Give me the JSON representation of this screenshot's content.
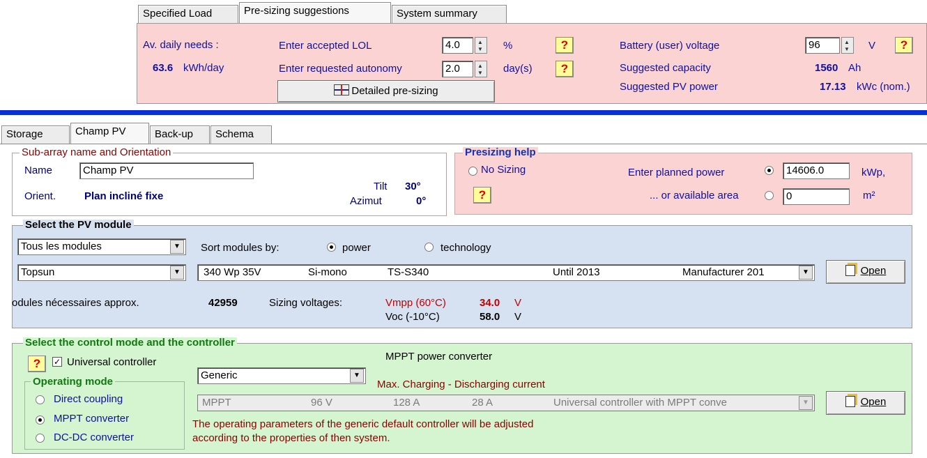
{
  "top_tabs": [
    "Specified Load",
    "Pre-sizing suggestions",
    "System summary"
  ],
  "presizing": {
    "av_daily_needs_label": "Av. daily needs :",
    "av_daily_value": "63.6",
    "av_daily_unit": "kWh/day",
    "lol_label": "Enter accepted LOL",
    "lol_value": "4.0",
    "lol_unit": "%",
    "autonomy_label": "Enter requested autonomy",
    "autonomy_value": "2.0",
    "autonomy_unit": "day(s)",
    "detailed_button": "Detailed pre-sizing",
    "battery_voltage_label": "Battery (user) voltage",
    "battery_voltage_value": "96",
    "battery_voltage_unit": "V",
    "capacity_label": "Suggested capacity",
    "capacity_value": "1560",
    "capacity_unit": "Ah",
    "pv_power_label": "Suggested PV power",
    "pv_power_value": "17.13",
    "pv_power_unit": "kWc (nom.)",
    "help_mark": "?"
  },
  "sub_tabs": [
    "Storage",
    "Champ PV",
    "Back-up",
    "Schema"
  ],
  "subarray": {
    "legend": "Sub-array name and Orientation",
    "name_label": "Name",
    "name_value": "Champ PV",
    "orient_label": "Orient.",
    "orient_value": "Plan incliné fixe",
    "tilt_label": "Tilt",
    "tilt_value": "30°",
    "azimut_label": "Azimut",
    "azimut_value": "0°"
  },
  "presizing_help": {
    "legend": "Presizing help",
    "no_sizing": "No Sizing",
    "planned_power_label": "Enter planned power",
    "planned_power_value": "14606.0",
    "planned_power_unit": "kWp,",
    "area_label": "... or available area",
    "area_value": "0",
    "area_unit": "m²"
  },
  "pv_module": {
    "legend": "Select the PV module",
    "filter_value": "Tous les modules",
    "sort_label": "Sort modules by:",
    "sort_power": "power",
    "sort_technology": "technology",
    "manufacturer_value": "Topsun",
    "module_cols": [
      "340 Wp 35V",
      "Si-mono",
      "TS-S340",
      "Until 2013",
      "Manufacturer 201"
    ],
    "open_button": "Open",
    "modules_needed_label": "odules nécessaires approx.",
    "modules_needed_value": "42959",
    "sizing_voltages_label": "Sizing voltages:",
    "vmpp_label": "Vmpp (60°C)",
    "vmpp_value": "34.0",
    "voc_label": "Voc  (-10°C)",
    "voc_value": "58.0",
    "volt_unit": "V"
  },
  "controller": {
    "legend": "Select the control mode and the controller",
    "universal_label": "Universal controller",
    "operating_mode_legend": "Operating mode",
    "modes": [
      "Direct coupling",
      "MPPT converter",
      "DC-DC converter"
    ],
    "selected_mode": "MPPT converter",
    "converter_title": "MPPT power converter",
    "generic_value": "Generic",
    "max_current_label": "Max. Charging - Discharging current",
    "controller_cols": [
      "MPPT",
      "96 V",
      "128 A",
      "28 A",
      "Universal controller with MPPT conve"
    ],
    "open_button": "Open",
    "note_line1": "The operating parameters of the generic default controller will be adjusted",
    "note_line2": "according to the properties of then system."
  },
  "colors": {
    "pink_panel": "#fbd3d3",
    "blue_panel": "#d6e2f1",
    "green_panel": "#d5f5d0",
    "separator": "#0b2fd6"
  }
}
